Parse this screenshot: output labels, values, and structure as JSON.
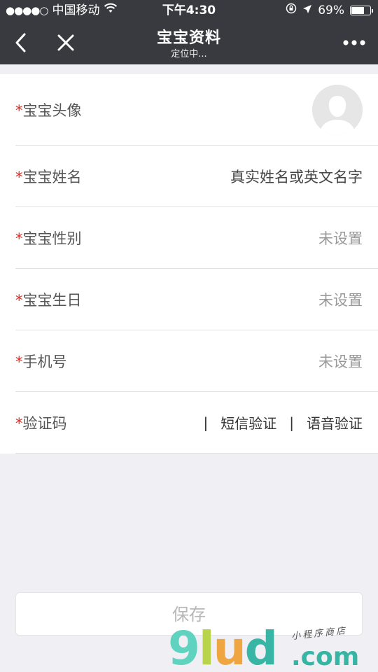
{
  "status_bar": {
    "signal_dots": "●●●●○",
    "carrier": "中国移动",
    "time": "下午4:30",
    "battery": "69%",
    "battery_level": 0.69
  },
  "nav": {
    "title": "宝宝资料",
    "subtitle": "定位中..."
  },
  "form": {
    "required_mark": "*",
    "rows": [
      {
        "label": "宝宝头像"
      },
      {
        "label": "宝宝姓名",
        "value": "真实姓名或英文名字"
      },
      {
        "label": "宝宝性别",
        "value": "未设置"
      },
      {
        "label": "宝宝生日",
        "value": "未设置"
      },
      {
        "label": "手机号",
        "value": "未设置"
      },
      {
        "label": "验证码"
      }
    ],
    "verify": {
      "separator": "|",
      "sms_label": "短信验证",
      "voice_label": "语音验证"
    }
  },
  "save_label": "保存",
  "watermark": {
    "g": "9",
    "l": "l",
    "u": "u",
    "d": "d",
    "com": ".com",
    "small": "小程序商店"
  },
  "colors": {
    "navbar": "#393a3f",
    "required": "#e5281f",
    "background": "#efeff4"
  }
}
